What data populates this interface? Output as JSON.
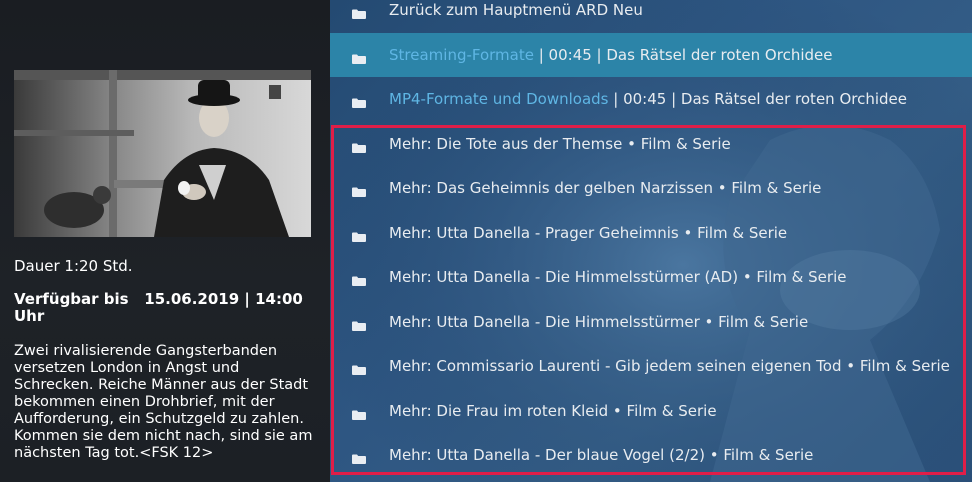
{
  "info": {
    "duration": "Dauer 1:20 Std.",
    "available": "Verfügbar bis   15.06.2019 | 14:00 Uhr",
    "plot": "Zwei rivalisierende Gangsterbanden versetzen London in Angst und Schrecken. Reiche Männer aus der Stadt bekommen einen Drohbrief, mit der Aufforderung, ein Schutzgeld zu zahlen. Kommen sie dem nicht nach, sind sie am nächsten Tag tot.<FSK 12>"
  },
  "list": {
    "items": [
      {
        "label": "Zurück zum Hauptmenü ARD Neu",
        "icon": "folder-icon"
      },
      {
        "accent": "Streaming-Formate",
        "rest": " | 00:45 | Das Rätsel der roten Orchidee",
        "icon": "folder-icon",
        "focused": true
      },
      {
        "accent": "MP4-Formate und Downloads",
        "rest": " | 00:45 | Das Rätsel der roten Orchidee",
        "icon": "folder-icon"
      },
      {
        "label": "Mehr: Die Tote aus der Themse • Film & Serie",
        "icon": "folder-icon"
      },
      {
        "label": "Mehr: Das Geheimnis der gelben Narzissen • Film & Serie",
        "icon": "folder-icon"
      },
      {
        "label": "Mehr: Utta Danella - Prager Geheimnis • Film & Serie",
        "icon": "folder-icon"
      },
      {
        "label": "Mehr: Utta Danella - Die Himmelsstürmer (AD) • Film & Serie",
        "icon": "folder-icon"
      },
      {
        "label": "Mehr: Utta Danella - Die Himmelsstürmer • Film & Serie",
        "icon": "folder-icon"
      },
      {
        "label": "Mehr: Commissario Laurenti - Gib jedem seinen eigenen Tod • Film & Serie",
        "icon": "folder-icon"
      },
      {
        "label": "Mehr: Die Frau im roten Kleid • Film & Serie",
        "icon": "folder-icon"
      },
      {
        "label": "Mehr: Utta Danella - Der blaue Vogel (2/2) • Film & Serie",
        "icon": "folder-icon"
      }
    ]
  },
  "colors": {
    "focus_bg": "#2c84a8",
    "accent_text": "#5fb6e4",
    "highlight_border": "#e01e48"
  }
}
